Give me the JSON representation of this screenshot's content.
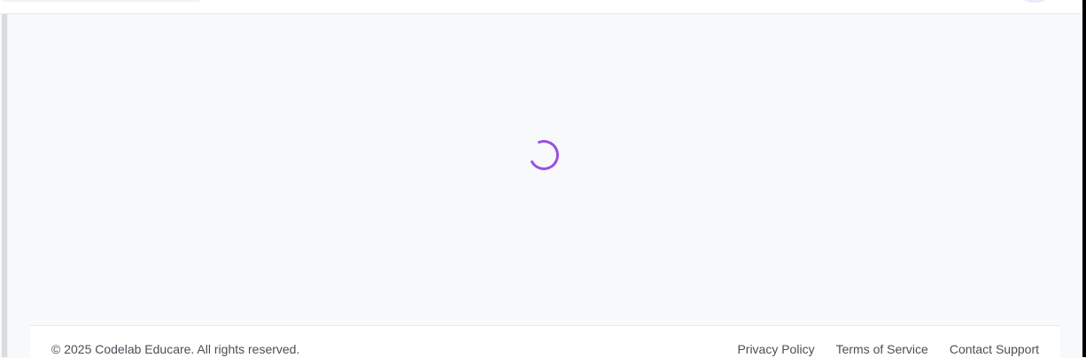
{
  "footer": {
    "copyright": "© 2025 Codelab Educare. All rights reserved.",
    "links": {
      "privacy": "Privacy Policy",
      "terms": "Terms of Service",
      "support": "Contact Support"
    }
  },
  "colors": {
    "accent": "#9b4fe0",
    "background": "#f8f9fb",
    "footer_text": "#4a4f57"
  },
  "icons": {
    "loading": "loading-spinner-icon"
  }
}
